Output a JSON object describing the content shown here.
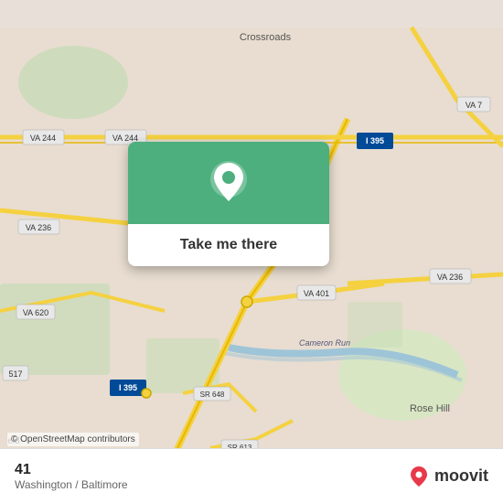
{
  "map": {
    "bg_color": "#e8ddd0",
    "center_lat": 38.82,
    "center_lng": -77.09
  },
  "card": {
    "bg_color": "#4CAF7D",
    "button_label": "Take me there",
    "pin_symbol": "📍"
  },
  "bottom_bar": {
    "location_name": "41",
    "location_region": "Washington / Baltimore",
    "logo_text": "moovit",
    "copyright": "© OpenStreetMap contributors"
  },
  "road_labels": [
    "VA 244",
    "VA 244",
    "VA 236",
    "VA 620",
    "I 395",
    "I 395",
    "VA 401",
    "SR 648",
    "SR 613",
    "VA 7",
    "I 395",
    "VA 236",
    "Crossroads",
    "Rose Hill",
    "Cameron Run"
  ]
}
